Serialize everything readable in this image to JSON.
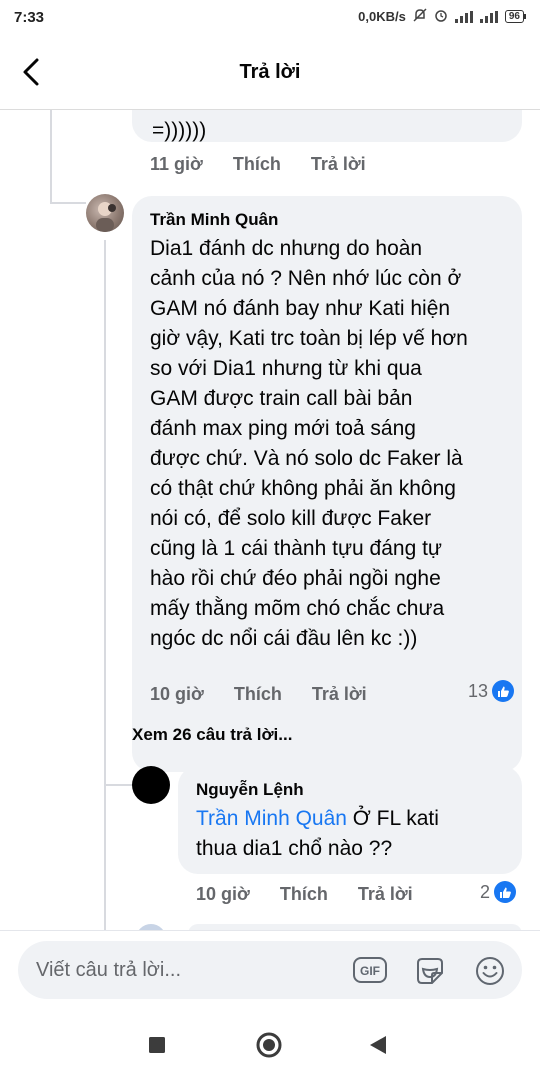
{
  "status_bar": {
    "time": "7:33",
    "network_speed": "0,0KB/s",
    "battery": "96"
  },
  "header": {
    "title": "Trả lời"
  },
  "thread": {
    "prev_comment": {
      "text_tail": "=))))))",
      "time": "11 giờ",
      "like_label": "Thích",
      "reply_label": "Trả lời"
    },
    "main_comment": {
      "author": "Trần Minh Quân",
      "text": "Dia1 đánh dc nhưng do hoàn cảnh của nó ? Nên nhớ lúc còn ở GAM nó đánh bay như Kati hiện giờ vậy, Kati trc toàn bị lép vế hơn so với Dia1 nhưng từ khi qua GAM được train call bài bản đánh max ping mới toả sáng được chứ. Và nó solo dc Faker là có thật chứ không phải ăn không nói có, để solo kill được Faker cũng là 1 cái thành tựu đáng tự hào rồi chứ đéo phải ngồi nghe mấy thằng mõm chó chắc chưa ngóc dc nổi cái đầu lên kc :))",
      "lines": [
        "Dia1 đánh dc nhưng do hoàn",
        "cảnh của nó ? Nên nhớ lúc còn ở",
        "GAM nó đánh bay như Kati hiện",
        "giờ vậy, Kati trc toàn bị lép vế hơn",
        "so với Dia1 nhưng từ khi qua",
        "GAM được train call bài bản",
        "đánh max ping mới toả sáng",
        "được chứ. Và nó solo dc Faker là",
        "có thật chứ không phải ăn không",
        "nói có, để solo kill được Faker",
        "cũng là 1 cái thành tựu đáng tự",
        "hào rồi chứ đéo phải ngồi nghe",
        "mấy thằng mõm chó chắc chưa",
        "ngóc dc nổi cái đầu lên kc :))"
      ],
      "time": "10 giờ",
      "like_label": "Thích",
      "reply_label": "Trả lời",
      "like_count": "13"
    },
    "view_replies": "Xem 26 câu trả lời...",
    "reply_comment": {
      "author": "Nguyễn Lệnh",
      "mention": "Trần Minh Quân",
      "text_line1": " Ở FL kati",
      "text_line2": "thua dia1 chổ nào ??",
      "time": "10 giờ",
      "like_label": "Thích",
      "reply_label": "Trả lời",
      "like_count": "2"
    }
  },
  "composer": {
    "placeholder": "Viết câu trả lời...",
    "gif_label": "GIF"
  },
  "colors": {
    "accent": "#1877f2",
    "bubble": "#f0f2f5",
    "meta_text": "#65676b"
  },
  "icons": [
    "back-arrow-icon",
    "gif-icon",
    "sticker-icon",
    "emoji-icon",
    "like-icon",
    "nav-recents-icon",
    "nav-home-icon",
    "nav-back-icon"
  ]
}
